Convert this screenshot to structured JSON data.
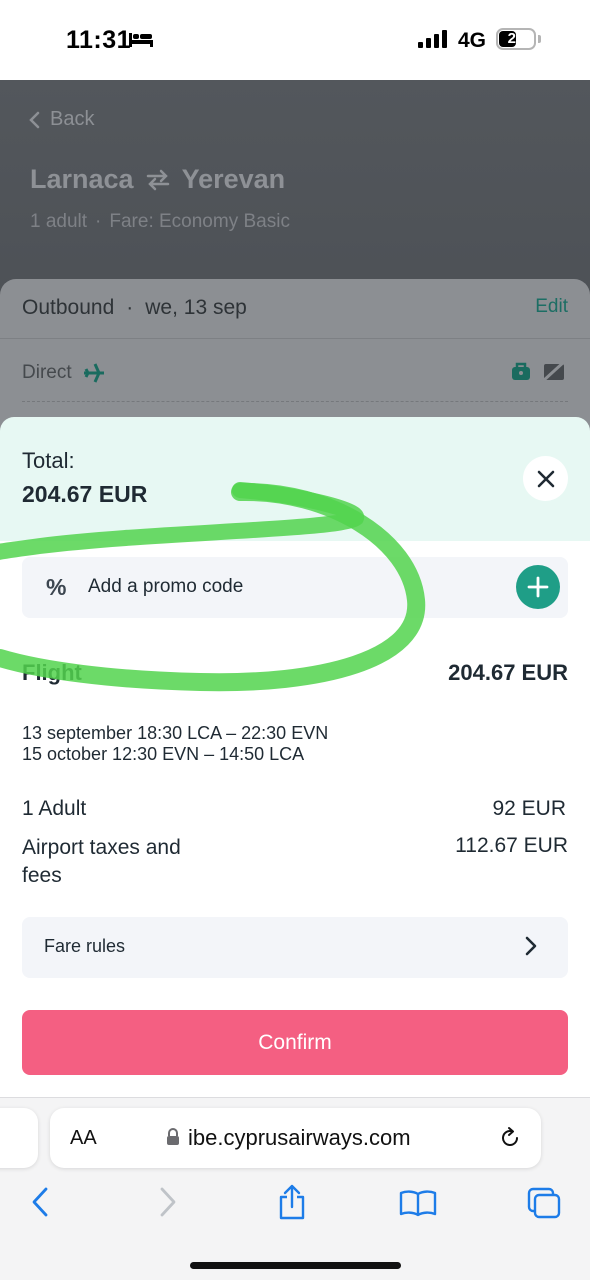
{
  "status_bar": {
    "time": "11:31",
    "network": "4G",
    "battery": "22"
  },
  "header": {
    "back_label": "Back",
    "origin": "Larnaca",
    "destination": "Yerevan",
    "passengers": "1 adult",
    "fare": "Fare: Economy Basic"
  },
  "outbound": {
    "label": "Outbound",
    "date": "we, 13 sep",
    "edit_label": "Edit",
    "stops": "Direct"
  },
  "total": {
    "label": "Total:",
    "value": "204.67 EUR"
  },
  "promo": {
    "icon_text": "%",
    "label": "Add a promo code"
  },
  "flight": {
    "label": "Flight",
    "price": "204.67 EUR",
    "segments": [
      "13 september 18:30 LCA – 22:30 EVN",
      "15 october 12:30 EVN – 14:50 LCA"
    ]
  },
  "pricing": {
    "adult_label": "1 Adult",
    "adult_value": "92 EUR",
    "taxes_label": "Airport taxes and fees",
    "taxes_value": "112.67 EUR"
  },
  "fare_rules_label": "Fare rules",
  "confirm_label": "Confirm",
  "browser": {
    "text_size": "AA",
    "url": "ibe.cyprusairways.com"
  },
  "colors": {
    "accent_teal": "#1f9e87",
    "confirm_pink": "#f45f82",
    "total_bg": "#e7f8f3",
    "scribble_green": "#52d34e"
  }
}
